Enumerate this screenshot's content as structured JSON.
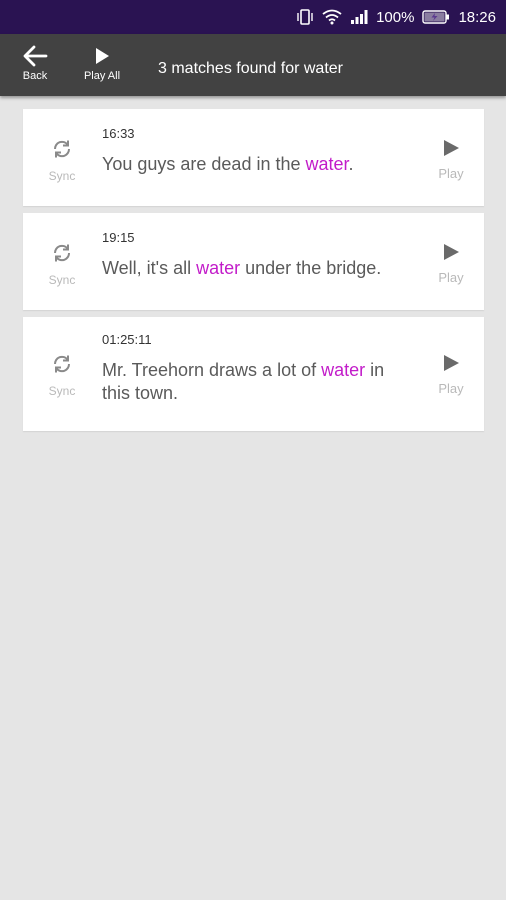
{
  "status_bar": {
    "battery_percent": "100%",
    "time": "18:26"
  },
  "toolbar": {
    "back_label": "Back",
    "play_all_label": "Play All",
    "title": "3 matches found for water"
  },
  "highlight_color": "#c21cc9",
  "results": [
    {
      "timestamp": "16:33",
      "text_before": "You guys are dead in the ",
      "match": "water",
      "text_after": ".",
      "sync_label": "Sync",
      "play_label": "Play"
    },
    {
      "timestamp": "19:15",
      "text_before": "Well, it's all ",
      "match": "water",
      "text_after": " under the bridge.",
      "sync_label": "Sync",
      "play_label": "Play"
    },
    {
      "timestamp": "01:25:11",
      "text_before": "Mr. Treehorn draws a lot of ",
      "match": "water",
      "text_after": " in this town.",
      "sync_label": "Sync",
      "play_label": "Play"
    }
  ]
}
